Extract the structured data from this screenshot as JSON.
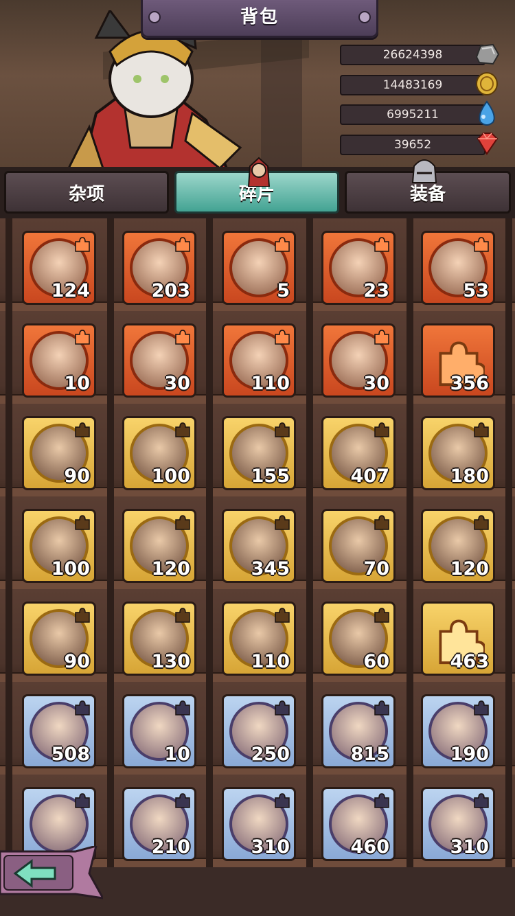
{
  "header": {
    "title": "背包"
  },
  "currencies": [
    {
      "value": "26624398",
      "icon": "stone-icon",
      "color": "#9a9a9a"
    },
    {
      "value": "14483169",
      "icon": "gold-coin-icon",
      "color": "#e0b53a"
    },
    {
      "value": "6995211",
      "icon": "water-drop-icon",
      "color": "#4aa3e6"
    },
    {
      "value": "39652",
      "icon": "ruby-gem-icon",
      "color": "#e0423b"
    }
  ],
  "tabs": [
    {
      "label": "杂项",
      "active": false
    },
    {
      "label": "碎片",
      "active": true
    },
    {
      "label": "装备",
      "active": false
    }
  ],
  "rows": [
    [
      {
        "rarity": "orange",
        "count": "124"
      },
      {
        "rarity": "orange",
        "count": "203"
      },
      {
        "rarity": "orange",
        "count": "5"
      },
      {
        "rarity": "orange",
        "count": "23"
      },
      {
        "rarity": "orange",
        "count": "53"
      }
    ],
    [
      {
        "rarity": "orange",
        "count": "10"
      },
      {
        "rarity": "orange",
        "count": "30"
      },
      {
        "rarity": "orange",
        "count": "110"
      },
      {
        "rarity": "orange",
        "count": "30"
      },
      {
        "rarity": "orange",
        "count": "356",
        "generic": true
      }
    ],
    [
      {
        "rarity": "gold",
        "count": "90"
      },
      {
        "rarity": "gold",
        "count": "100"
      },
      {
        "rarity": "gold",
        "count": "155"
      },
      {
        "rarity": "gold",
        "count": "407"
      },
      {
        "rarity": "gold",
        "count": "180"
      }
    ],
    [
      {
        "rarity": "gold",
        "count": "100"
      },
      {
        "rarity": "gold",
        "count": "120"
      },
      {
        "rarity": "gold",
        "count": "345"
      },
      {
        "rarity": "gold",
        "count": "70"
      },
      {
        "rarity": "gold",
        "count": "120"
      }
    ],
    [
      {
        "rarity": "gold",
        "count": "90"
      },
      {
        "rarity": "gold",
        "count": "130"
      },
      {
        "rarity": "gold",
        "count": "110"
      },
      {
        "rarity": "gold",
        "count": "60"
      },
      {
        "rarity": "gold",
        "count": "463",
        "generic": true
      }
    ],
    [
      {
        "rarity": "blue",
        "count": "508"
      },
      {
        "rarity": "blue",
        "count": "10"
      },
      {
        "rarity": "blue",
        "count": "250"
      },
      {
        "rarity": "blue",
        "count": "815"
      },
      {
        "rarity": "blue",
        "count": "190"
      }
    ],
    [
      {
        "rarity": "blue",
        "count": ""
      },
      {
        "rarity": "blue",
        "count": "210"
      },
      {
        "rarity": "blue",
        "count": "310"
      },
      {
        "rarity": "blue",
        "count": "460"
      },
      {
        "rarity": "blue",
        "count": "310"
      }
    ]
  ],
  "back_button": {
    "icon": "back-arrow-icon"
  }
}
